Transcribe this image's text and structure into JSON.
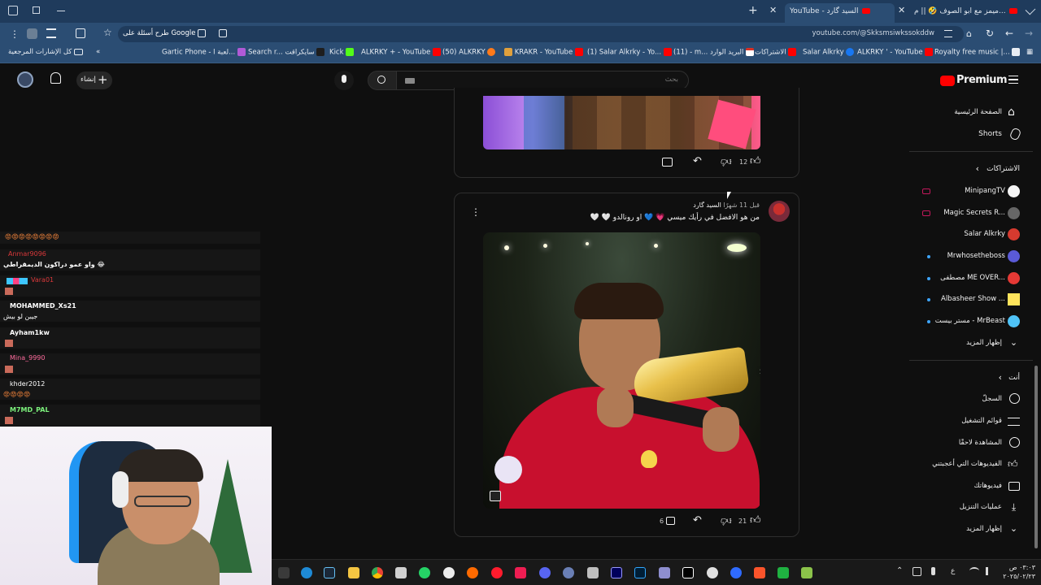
{
  "browser": {
    "tabs": [
      {
        "label": "ميمز مع ابو الصوف 🤣 || م...",
        "active": false
      },
      {
        "label": "YouTube - السيد گارد",
        "active": true
      }
    ],
    "new_tab": "+",
    "url": "youtube.com/@Skksmsiwkssokddw",
    "translate_chip": "طرح أسئلة على Google",
    "bookmarks": [
      {
        "label": "Gartic Phone - لعبة ا...",
        "icon": "gartic-icon"
      },
      {
        "label": "Search r... سايكراقت",
        "icon": "search-bm-icon"
      },
      {
        "label": "Kick",
        "icon": "kick-icon"
      },
      {
        "label": "ALKRKY + - YouTube",
        "icon": "youtube-icon"
      },
      {
        "label": "(50) ALKRKY",
        "icon": "youtube-icon"
      },
      {
        "label": "KRAKR - YouTube",
        "icon": "youtube-icon"
      },
      {
        "label": "(1) Salar Alkrky - Yo...",
        "icon": "youtube-icon"
      },
      {
        "label": "(11) - m... البريد الوارد",
        "icon": "gmail-icon"
      },
      {
        "label": "الاشتراكات",
        "icon": "youtube-icon"
      },
      {
        "label": "Salar Alkrky",
        "icon": "facebook-icon"
      },
      {
        "label": "ALKRKY ' - YouTube",
        "icon": "youtube-icon"
      },
      {
        "label": "Royalty free music |...",
        "icon": "music-icon"
      }
    ],
    "all_bookmarks": "كل الإشارات المرجعية"
  },
  "youtube": {
    "brand": "Premium",
    "search_placeholder": "بحث",
    "create_label": "إنشاء",
    "sidebar": {
      "home": "الصفحة الرئيسية",
      "shorts": "Shorts",
      "subscriptions_header": "الاشتراكات",
      "subscriptions": [
        {
          "name": "MinipangTV",
          "live": true
        },
        {
          "name": "Magic Secrets R...",
          "live": true
        },
        {
          "name": "Salar Alkrky",
          "live": false
        },
        {
          "name": "Mrwhosetheboss",
          "live": false,
          "dot": true
        },
        {
          "name": "مصطفى ME OVER...",
          "live": false,
          "dot": true
        },
        {
          "name": "Albasheer Show ...",
          "live": false,
          "dot": true
        },
        {
          "name": "مستر بيست - MrBeast",
          "live": false,
          "dot": true
        }
      ],
      "show_more": "إظهار المزيد",
      "you_header": "أنت",
      "you_items": [
        {
          "label": "السجلّ",
          "icon": "history-icon"
        },
        {
          "label": "قوائم التشغيل",
          "icon": "playlist-icon"
        },
        {
          "label": "المشاهدة لاحقًا",
          "icon": "clock-icon"
        },
        {
          "label": "الفيديوهات التي أعجبتني",
          "icon": "like-icon"
        },
        {
          "label": "فيديوهاتك",
          "icon": "your-videos-icon"
        },
        {
          "label": "عمليات التنزيل",
          "icon": "download-icon"
        }
      ],
      "show_more_2": "إظهار المزيد"
    },
    "posts": [
      {
        "likes": "12",
        "comments": ""
      },
      {
        "author": "السيد گارد",
        "time": "قبل 11 شهرًا",
        "text": "من هو الافضل في رأيك ميسي 💗 💙 او رونالدو 🤍 🤍",
        "likes": "21",
        "comments": "6"
      }
    ]
  },
  "chat": {
    "lines": [
      {
        "user": "😡😡😡😡😡😡😡😡",
        "msg": "",
        "color": "#ff8a3d"
      },
      {
        "user": "Anmar9096",
        "msg": "واو عمو دراكون الديمقراطي 😂",
        "color": "#d9383a"
      },
      {
        "user": "Vara01",
        "msg": "",
        "color": "#d9383a"
      },
      {
        "user": "MOHAMMED_Xs21",
        "msg": "جيبن لو بيش",
        "color": "#ffffff"
      },
      {
        "user": "Ayham1kw",
        "msg": "",
        "color": "#ffffff"
      },
      {
        "user": "Mina_9990",
        "msg": "",
        "color": "#ff6b9d"
      },
      {
        "user": "khder2012",
        "msg": "😡😡😡😡",
        "color": "#ffffff"
      },
      {
        "user": "M7MD_PAL",
        "msg": "",
        "color": "#7cf27c"
      }
    ]
  },
  "taskbar": {
    "time": "٠٣:٠٣ ص",
    "date": "٢٠٢٥/٠٢/٢٣",
    "lang": "ع"
  },
  "colors": {
    "tab_bg": "#1f3b5c",
    "address_bg": "#2b4d73",
    "yt_red": "#ff0000",
    "page_bg": "#0f0f0f"
  }
}
